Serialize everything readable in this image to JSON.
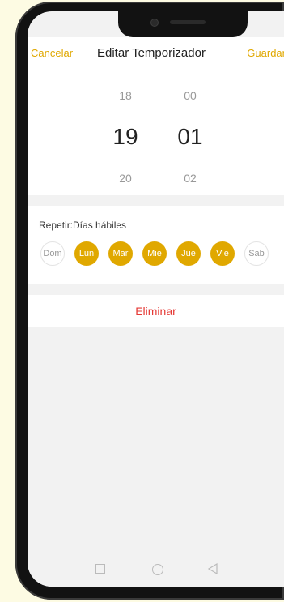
{
  "header": {
    "cancel_label": "Cancelar",
    "title": "Editar Temporizador",
    "save_label": "Guardar"
  },
  "time_picker": {
    "hours": {
      "prev": "18",
      "selected": "19",
      "next": "20"
    },
    "minutes": {
      "prev": "00",
      "selected": "01",
      "next": "02"
    }
  },
  "repeat": {
    "label": "Repetir:Días hábiles",
    "days": [
      {
        "label": "Dom",
        "selected": false
      },
      {
        "label": "Lun",
        "selected": true
      },
      {
        "label": "Mar",
        "selected": true
      },
      {
        "label": "Mie",
        "selected": true
      },
      {
        "label": "Jue",
        "selected": true
      },
      {
        "label": "Vie",
        "selected": true
      },
      {
        "label": "Sab",
        "selected": false
      }
    ]
  },
  "actions": {
    "delete_label": "Eliminar"
  },
  "colors": {
    "accent": "#e0a800",
    "danger": "#e53935",
    "background": "#fdfbe3"
  }
}
